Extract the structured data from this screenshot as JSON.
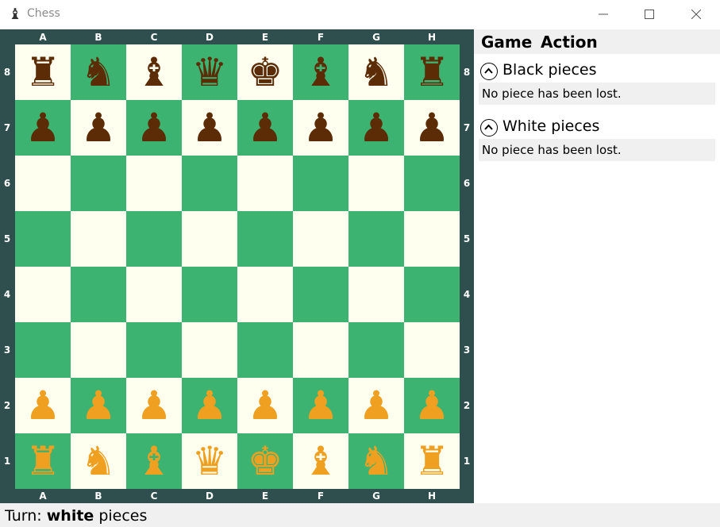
{
  "window": {
    "title": "Chess",
    "app_icon": "♝"
  },
  "board": {
    "files": [
      "A",
      "B",
      "C",
      "D",
      "E",
      "F",
      "G",
      "H"
    ],
    "ranks": [
      "8",
      "7",
      "6",
      "5",
      "4",
      "3",
      "2",
      "1"
    ],
    "light_color": "#fffff0",
    "dark_color": "#3cb371",
    "frame_color": "#2f4f4f",
    "position": [
      [
        "bR",
        "bN",
        "bB",
        "bQ",
        "bK",
        "bB",
        "bN",
        "bR"
      ],
      [
        "bP",
        "bP",
        "bP",
        "bP",
        "bP",
        "bP",
        "bP",
        "bP"
      ],
      [
        "",
        "",
        "",
        "",
        "",
        "",
        "",
        ""
      ],
      [
        "",
        "",
        "",
        "",
        "",
        "",
        "",
        ""
      ],
      [
        "",
        "",
        "",
        "",
        "",
        "",
        "",
        ""
      ],
      [
        "",
        "",
        "",
        "",
        "",
        "",
        "",
        ""
      ],
      [
        "wP",
        "wP",
        "wP",
        "wP",
        "wP",
        "wP",
        "wP",
        "wP"
      ],
      [
        "wR",
        "wN",
        "wB",
        "wQ",
        "wK",
        "wB",
        "wN",
        "wR"
      ]
    ],
    "piece_glyphs": {
      "K": "♚",
      "Q": "♛",
      "R": "♜",
      "B": "♝",
      "N": "♞",
      "P": "♟"
    },
    "black_piece_color": "#5c2c06",
    "white_piece_color": "#f0a020"
  },
  "menu": {
    "game": "Game",
    "action": "Action"
  },
  "sections": {
    "black": {
      "title": "Black pieces",
      "body": "No piece has been lost."
    },
    "white": {
      "title": "White pieces",
      "body": "No piece has been lost."
    }
  },
  "status": {
    "prefix": "Turn: ",
    "side": "white",
    "suffix": " pieces"
  }
}
